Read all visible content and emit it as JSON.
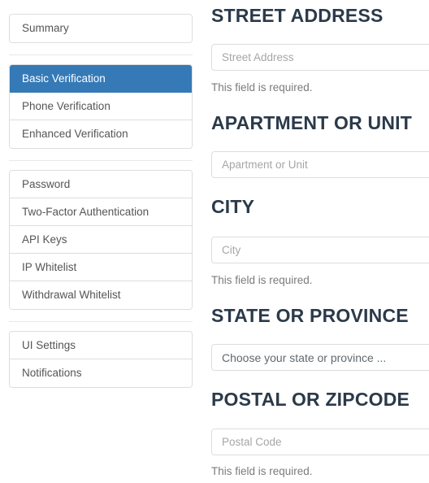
{
  "sidebar": {
    "groups": [
      {
        "name": "account-group",
        "items": [
          {
            "label": "Summary",
            "active": false
          }
        ]
      },
      {
        "name": "verification-group",
        "items": [
          {
            "label": "Basic Verification",
            "active": true
          },
          {
            "label": "Phone Verification",
            "active": false
          },
          {
            "label": "Enhanced Verification",
            "active": false
          }
        ]
      },
      {
        "name": "security-group",
        "items": [
          {
            "label": "Password",
            "active": false
          },
          {
            "label": "Two-Factor Authentication",
            "active": false
          },
          {
            "label": "API Keys",
            "active": false
          },
          {
            "label": "IP Whitelist",
            "active": false
          },
          {
            "label": "Withdrawal Whitelist",
            "active": false
          }
        ]
      },
      {
        "name": "preferences-group",
        "items": [
          {
            "label": "UI Settings",
            "active": false
          },
          {
            "label": "Notifications",
            "active": false
          }
        ]
      }
    ]
  },
  "form": {
    "fields": [
      {
        "name": "street-address",
        "label": "STREET ADDRESS",
        "placeholder": "Street Address",
        "value": "",
        "help": "This field is required.",
        "control": "input"
      },
      {
        "name": "apartment-or-unit",
        "label": "APARTMENT OR UNIT",
        "placeholder": "Apartment or Unit",
        "value": "",
        "help": "",
        "control": "input"
      },
      {
        "name": "city",
        "label": "CITY",
        "placeholder": "City",
        "value": "",
        "help": "This field is required.",
        "control": "input"
      },
      {
        "name": "state-or-province",
        "label": "STATE OR PROVINCE",
        "placeholder": "Choose your state or province ...",
        "value": "Choose your state or province ...",
        "help": "",
        "control": "select"
      },
      {
        "name": "postal-or-zipcode",
        "label": "POSTAL OR ZIPCODE",
        "placeholder": "Postal Code",
        "value": "",
        "help": "This field is required.",
        "control": "input"
      }
    ]
  },
  "colors": {
    "accent": "#357ab7",
    "heading": "#2b3a4a",
    "border": "#dddddd",
    "muted_text": "#7b7b7b",
    "placeholder": "#a6a6a6",
    "nav_text": "#555555"
  }
}
